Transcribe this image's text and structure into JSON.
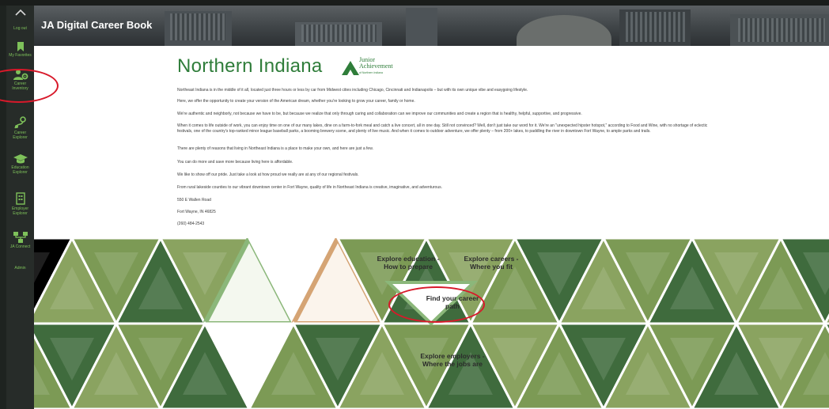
{
  "header": {
    "title": "JA Digital Career Book"
  },
  "sidebar": {
    "items": [
      {
        "label": "Log out",
        "icon": "logout"
      },
      {
        "label": "My Favorites",
        "icon": "bookmark-icon"
      },
      {
        "label": "Career Inventory",
        "icon": "people-gear-icon"
      },
      {
        "label": "Career Explorer",
        "icon": "career-explorer-icon"
      },
      {
        "label": "Education Explorer",
        "icon": "graduation-cap-icon"
      },
      {
        "label": "Employer Explorer",
        "icon": "building-icon"
      },
      {
        "label": "JA Connect",
        "icon": "network-icon"
      },
      {
        "label": "Admin",
        "icon": ""
      }
    ]
  },
  "page": {
    "title": "Northern Indiana",
    "logo": {
      "line1": "Junior",
      "line2": "Achievement",
      "sub": "of Northern Indiana"
    },
    "paragraphs": [
      "Northeast Indiana is in the middle of it all, located just three hours or less by car from Midwest cities including Chicago, Cincinnati and Indianapolis – but with its own unique vibe and easygoing lifestyle.",
      "Here, we offer the opportunity to create your version of the American dream, whether you're looking to grow your career, family or home.",
      "We're authentic and neighborly, not because we have to be, but because we realize that only through caring and collaboration can we improve our communities and create a region that is healthy, helpful, supportive, and progressive.",
      "When it comes to life outside of work, you can enjoy time on one of our many lakes, dine on a farm-to-fork meal and catch a live concert, all in one day. Still not convinced? Well, don't just take our word for it. We're an \"unexpected hipster hotspot,\" according to Food and Wine, with no shortage of eclectic festivals, one of the country's top-ranked minor league baseball parks, a booming brewery scene, and plenty of live music. And when it comes to outdoor adventure, we offer plenty – from 200+ lakes, to paddling the river in downtown Fort Wayne, to ample parks and trails.",
      "There are plenty of reasons that living in Northeast Indiana is a place to make your own, and here are just a few.",
      "You can do more and save more because living here is affordable.",
      "We like to show off our pride. Just take a look at how proud we really are at any of our regional festivals.",
      "From rural lakeside counties to our vibrant downtown center in Fort Wayne, quality of life in Northeast Indiana is creative, imaginative, and adventurous.",
      "550 E Wallen Road",
      "Fort Wayne, IN 46825",
      "(260) 484-2543"
    ]
  },
  "tiles": {
    "education": "Explore education - How to prepare",
    "careers": "Explore careers - Where you fit",
    "path": "Find your career path",
    "employers": "Explore employers - Where the jobs are"
  },
  "colors": {
    "green": "#2f7d3a",
    "sidebar_green": "#7ec15a",
    "annotation": "#d8192a",
    "orange": "#c4773f"
  }
}
